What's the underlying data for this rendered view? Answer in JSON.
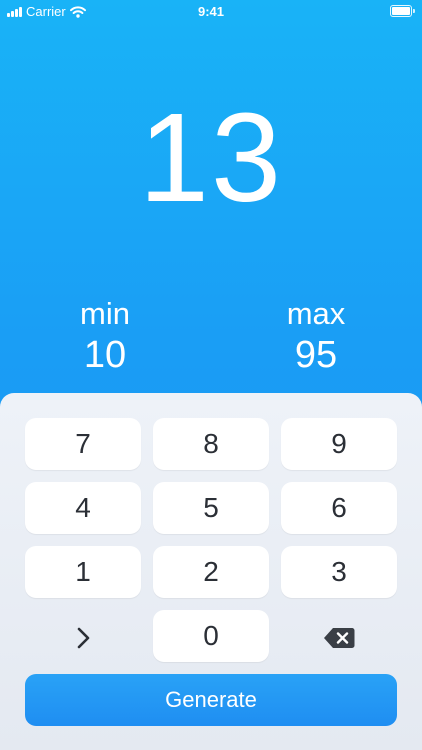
{
  "status_bar": {
    "carrier": "Carrier",
    "time": "9:41"
  },
  "result": {
    "value": "13"
  },
  "range": {
    "min_label": "min",
    "min_value": "10",
    "max_label": "max",
    "max_value": "95"
  },
  "keypad": {
    "keys": [
      "7",
      "8",
      "9",
      "4",
      "5",
      "6",
      "1",
      "2",
      "3",
      "0"
    ],
    "next_icon": "chevron-right-icon",
    "delete_icon": "backspace-icon"
  },
  "generate_button": {
    "label": "Generate"
  },
  "colors": {
    "background_top": "#19b3f7",
    "background_bottom": "#1b8cf2",
    "panel": "#e8edf4",
    "accent": "#1f8ef2",
    "key": "#ffffff",
    "key_text": "#2b2f36"
  }
}
